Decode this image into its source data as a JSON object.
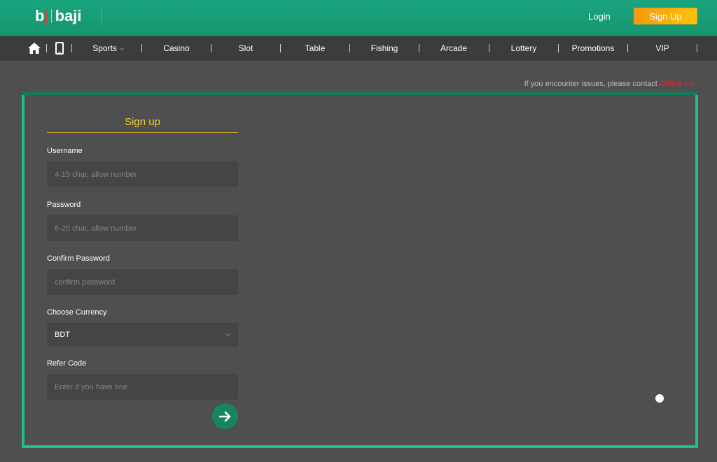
{
  "header": {
    "logo_mark_b": "b",
    "logo_mark_j": "j",
    "logo_text": "baji",
    "login_label": "Login",
    "signup_label": "Sign Up"
  },
  "nav": {
    "items": [
      {
        "label": "Sports",
        "has_dropdown": true
      },
      {
        "label": "Casino"
      },
      {
        "label": "Slot"
      },
      {
        "label": "Table"
      },
      {
        "label": "Fishing"
      },
      {
        "label": "Arcade"
      },
      {
        "label": "Lottery"
      },
      {
        "label": "Promotions"
      },
      {
        "label": "VIP"
      }
    ],
    "dropdown_glyph": "⌵"
  },
  "notice": {
    "text": "If you encounter issues, please contact ",
    "link": "Online CS"
  },
  "form": {
    "title": "Sign up",
    "username_label": "Username",
    "username_placeholder": "4-15 char, allow number",
    "password_label": "Password",
    "password_placeholder": "6-20 char, allow number",
    "confirm_label": "Confirm Password",
    "confirm_placeholder": "confirm password",
    "currency_label": "Choose Currency",
    "currency_value": "BDT",
    "currency_chevron": "⌵",
    "refer_label": "Refer Code",
    "refer_placeholder": "Enter if you have one"
  },
  "colors": {
    "brand_green": "#1aa57e",
    "accent_yellow": "#f4d020",
    "signup_orange": "#f59a0c",
    "frame_green": "#1fbf8c",
    "link_red": "#e02b2b"
  }
}
